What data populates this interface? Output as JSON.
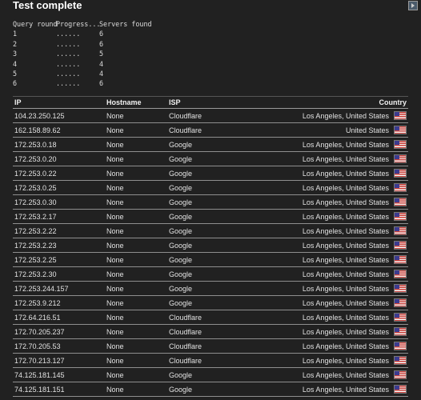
{
  "title": "Test complete",
  "query": {
    "header": {
      "round": "Query round",
      "progress": "Progress...",
      "servers": "Servers found"
    },
    "rows": [
      {
        "round": "1",
        "progress": "......",
        "servers": "6"
      },
      {
        "round": "2",
        "progress": "......",
        "servers": "6"
      },
      {
        "round": "3",
        "progress": "......",
        "servers": "5"
      },
      {
        "round": "4",
        "progress": "......",
        "servers": "4"
      },
      {
        "round": "5",
        "progress": "......",
        "servers": "4"
      },
      {
        "round": "6",
        "progress": "......",
        "servers": "6"
      }
    ]
  },
  "table": {
    "headers": {
      "ip": "IP",
      "hostname": "Hostname",
      "isp": "ISP",
      "country": "Country"
    },
    "rows": [
      {
        "ip": "104.23.250.125",
        "hostname": "None",
        "isp": "Cloudflare",
        "country": "Los Angeles, United States"
      },
      {
        "ip": "162.158.89.62",
        "hostname": "None",
        "isp": "Cloudflare",
        "country": "United States"
      },
      {
        "ip": "172.253.0.18",
        "hostname": "None",
        "isp": "Google",
        "country": "Los Angeles, United States"
      },
      {
        "ip": "172.253.0.20",
        "hostname": "None",
        "isp": "Google",
        "country": "Los Angeles, United States"
      },
      {
        "ip": "172.253.0.22",
        "hostname": "None",
        "isp": "Google",
        "country": "Los Angeles, United States"
      },
      {
        "ip": "172.253.0.25",
        "hostname": "None",
        "isp": "Google",
        "country": "Los Angeles, United States"
      },
      {
        "ip": "172.253.0.30",
        "hostname": "None",
        "isp": "Google",
        "country": "Los Angeles, United States"
      },
      {
        "ip": "172.253.2.17",
        "hostname": "None",
        "isp": "Google",
        "country": "Los Angeles, United States"
      },
      {
        "ip": "172.253.2.22",
        "hostname": "None",
        "isp": "Google",
        "country": "Los Angeles, United States"
      },
      {
        "ip": "172.253.2.23",
        "hostname": "None",
        "isp": "Google",
        "country": "Los Angeles, United States"
      },
      {
        "ip": "172.253.2.25",
        "hostname": "None",
        "isp": "Google",
        "country": "Los Angeles, United States"
      },
      {
        "ip": "172.253.2.30",
        "hostname": "None",
        "isp": "Google",
        "country": "Los Angeles, United States"
      },
      {
        "ip": "172.253.244.157",
        "hostname": "None",
        "isp": "Google",
        "country": "Los Angeles, United States"
      },
      {
        "ip": "172.253.9.212",
        "hostname": "None",
        "isp": "Google",
        "country": "Los Angeles, United States"
      },
      {
        "ip": "172.64.216.51",
        "hostname": "None",
        "isp": "Cloudflare",
        "country": "Los Angeles, United States"
      },
      {
        "ip": "172.70.205.237",
        "hostname": "None",
        "isp": "Cloudflare",
        "country": "Los Angeles, United States"
      },
      {
        "ip": "172.70.205.53",
        "hostname": "None",
        "isp": "Cloudflare",
        "country": "Los Angeles, United States"
      },
      {
        "ip": "172.70.213.127",
        "hostname": "None",
        "isp": "Cloudflare",
        "country": "Los Angeles, United States"
      },
      {
        "ip": "74.125.181.145",
        "hostname": "None",
        "isp": "Google",
        "country": "Los Angeles, United States"
      },
      {
        "ip": "74.125.181.151",
        "hostname": "None",
        "isp": "Google",
        "country": "Los Angeles, United States"
      }
    ]
  },
  "icons": {
    "flag": "us-flag-icon",
    "corner": "expand-icon"
  },
  "colors": {
    "background": "#212121",
    "text": "#e6e6e6",
    "divider": "#8e8e8e"
  }
}
